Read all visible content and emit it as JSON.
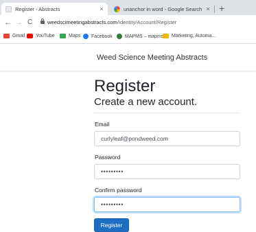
{
  "browser": {
    "tabs": [
      {
        "title": "Register - Abstracts",
        "close": "×",
        "active": true
      },
      {
        "title": "unanchor in word - Google Search",
        "close": "×",
        "active": false
      }
    ],
    "new_tab": "+",
    "back": "←",
    "forward": "→",
    "reload": "C",
    "url_host": "weedscimeetingabstracts.com",
    "url_path": "/Identity/Account/Register",
    "bookmarks": [
      {
        "label": "Gmail",
        "color": "#ea4335"
      },
      {
        "label": "YouTube",
        "color": "#ff0000"
      },
      {
        "label": "Maps",
        "color": "#34a853"
      },
      {
        "label": "Facebook",
        "color": "#1877f2"
      },
      {
        "label": "MAPMS – mapms",
        "color": "#2e7d32"
      },
      {
        "label": "Marketing, Automa...",
        "color": "#f4b400"
      }
    ]
  },
  "site": {
    "brand": "Weed Science Meeting Abstracts"
  },
  "form": {
    "heading": "Register",
    "subheading": "Create a new account.",
    "email_label": "Email",
    "email_value": "curlyleaf@pondweed.com",
    "password_label": "Password",
    "password_value": "•••••••••",
    "confirm_label": "Confirm password",
    "confirm_value": "•••••••••",
    "submit_label": "Register"
  },
  "colors": {
    "accent": "#1b6ec2",
    "focus": "#80bdff"
  }
}
